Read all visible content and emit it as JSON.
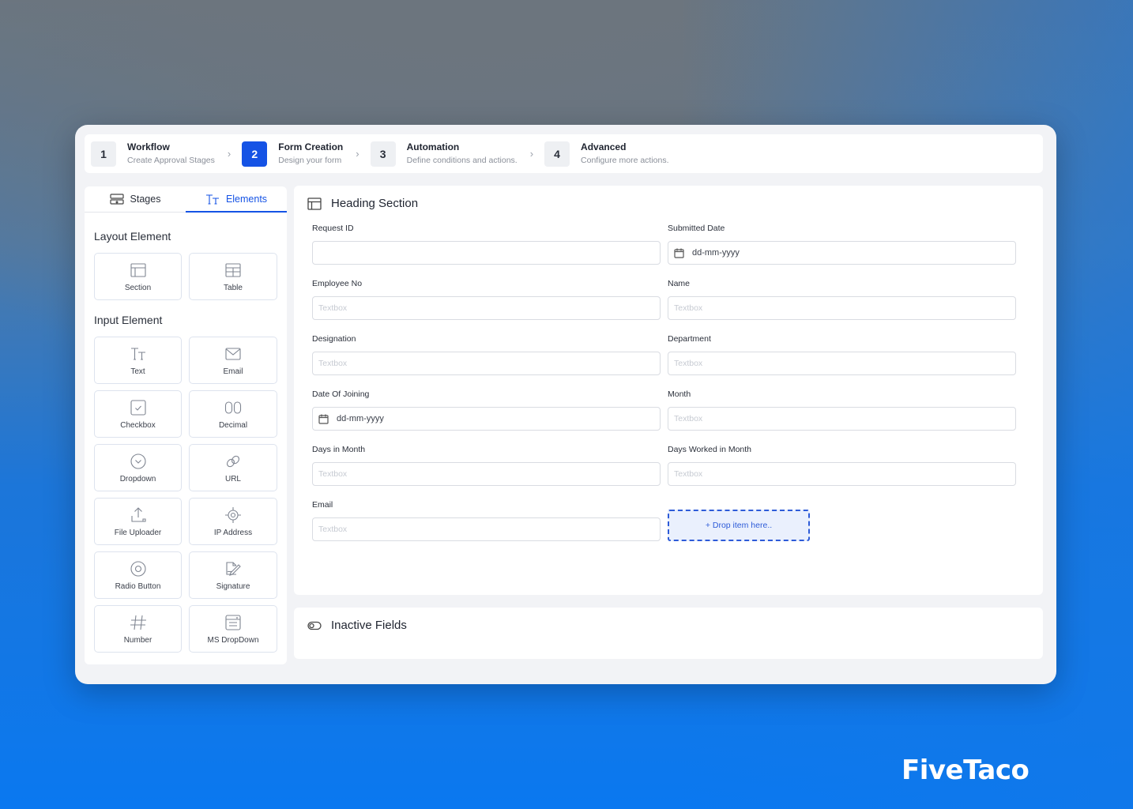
{
  "stepper": {
    "steps": [
      {
        "number": "1",
        "title": "Workflow",
        "subtitle": "Create Approval Stages",
        "active": false
      },
      {
        "number": "2",
        "title": "Form Creation",
        "subtitle": "Design your form",
        "active": true
      },
      {
        "number": "3",
        "title": "Automation",
        "subtitle": "Define conditions and actions.",
        "active": false
      },
      {
        "number": "4",
        "title": "Advanced",
        "subtitle": "Configure more actions.",
        "active": false
      }
    ],
    "separator_icon": "chevron-right-icon",
    "active_color": "#1553e5"
  },
  "sidebar": {
    "tabs": [
      {
        "label": "Stages",
        "icon": "stages-icon",
        "active": false
      },
      {
        "label": "Elements",
        "icon": "text-size-icon",
        "active": true
      }
    ],
    "layout_group": {
      "title": "Layout Element",
      "items": [
        {
          "label": "Section",
          "icon": "section-icon"
        },
        {
          "label": "Table",
          "icon": "table-icon"
        }
      ]
    },
    "input_group": {
      "title": "Input Element",
      "items": [
        {
          "label": "Text",
          "icon": "text-icon"
        },
        {
          "label": "Email",
          "icon": "email-icon"
        },
        {
          "label": "Checkbox",
          "icon": "checkbox-icon"
        },
        {
          "label": "Decimal",
          "icon": "decimal-icon"
        },
        {
          "label": "Dropdown",
          "icon": "dropdown-icon"
        },
        {
          "label": "URL",
          "icon": "link-icon"
        },
        {
          "label": "File Uploader",
          "icon": "upload-icon"
        },
        {
          "label": "IP Address",
          "icon": "target-icon"
        },
        {
          "label": "Radio Button",
          "icon": "radio-icon"
        },
        {
          "label": "Signature",
          "icon": "signature-icon"
        },
        {
          "label": "Number",
          "icon": "hash-icon"
        },
        {
          "label": "MS DropDown",
          "icon": "multiselect-icon"
        }
      ]
    }
  },
  "form": {
    "section_title": "Heading Section",
    "fields": {
      "request_id": {
        "label": "Request ID",
        "value": "",
        "placeholder": ""
      },
      "submitted_date": {
        "label": "Submitted Date",
        "value": "dd-mm-yyyy"
      },
      "employee_no": {
        "label": "Employee No",
        "placeholder": "Textbox"
      },
      "name": {
        "label": "Name",
        "placeholder": "Textbox"
      },
      "designation": {
        "label": "Designation",
        "placeholder": "Textbox"
      },
      "department": {
        "label": "Department",
        "placeholder": "Textbox"
      },
      "date_of_joining": {
        "label": "Date Of Joining",
        "value": "dd-mm-yyyy"
      },
      "month": {
        "label": "Month",
        "placeholder": "Textbox"
      },
      "days_in_month": {
        "label": "Days in Month",
        "placeholder": "Textbox"
      },
      "days_worked": {
        "label": "Days Worked in Month",
        "placeholder": "Textbox"
      },
      "email": {
        "label": "Email",
        "placeholder": "Textbox"
      }
    },
    "drop_zone_label": "+ Drop item here.."
  },
  "inactive": {
    "title": "Inactive Fields"
  },
  "brand": {
    "name": "FiveTaco"
  }
}
